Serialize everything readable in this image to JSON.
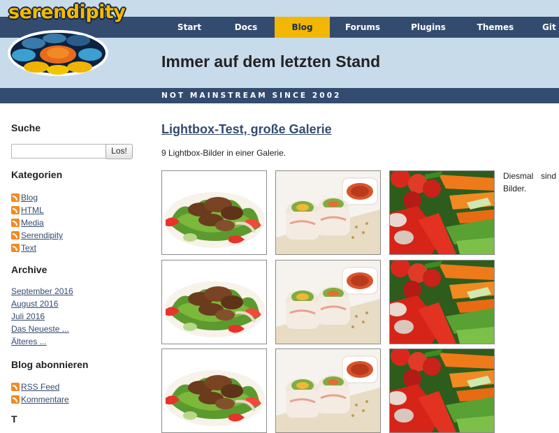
{
  "site": {
    "logo_text": "serendipity",
    "tagline": "Immer auf dem letzten Stand",
    "slogan": "NOT MAINSTREAM SINCE 2002"
  },
  "nav": {
    "items": [
      {
        "label": "Start"
      },
      {
        "label": "Docs"
      },
      {
        "label": "Blog",
        "active": true
      },
      {
        "label": "Forums"
      },
      {
        "label": "Plugins"
      },
      {
        "label": "Themes"
      },
      {
        "label": "Git"
      }
    ]
  },
  "sidebar": {
    "search": {
      "title": "Suche",
      "value": "",
      "placeholder": "",
      "button": "Los!"
    },
    "categories": {
      "title": "Kategorien",
      "items": [
        "Blog",
        "HTML",
        "Media",
        "Serendipity",
        "Text"
      ]
    },
    "archive": {
      "title": "Archive",
      "items": [
        "September 2016",
        "August 2016",
        "Juli 2016",
        "Das Neueste ...",
        "Älteres ..."
      ]
    },
    "subscribe": {
      "title": "Blog abonnieren",
      "items": [
        "RSS Feed",
        "Kommentare"
      ]
    },
    "next_title": "T"
  },
  "post": {
    "title": "Lightbox-Test, große Galerie",
    "subtitle": "9 Lightbox-Bilder in einer Galerie.",
    "side_text": "Diesmal sind Bilder.",
    "gallery": [
      {
        "row": 1,
        "images": [
          "salad-image",
          "rolls-image",
          "vegetables-image"
        ]
      },
      {
        "row": 2,
        "images": [
          "salad-image",
          "rolls-image",
          "vegetables-image"
        ]
      },
      {
        "row": 3,
        "images": [
          "salad-image",
          "rolls-image",
          "vegetables-image"
        ]
      }
    ]
  },
  "colors": {
    "header_bg": "#c7dbea",
    "nav_bg": "#344b70",
    "nav_active": "#f2b705",
    "link": "#344b70",
    "rss": "#f08a24"
  }
}
